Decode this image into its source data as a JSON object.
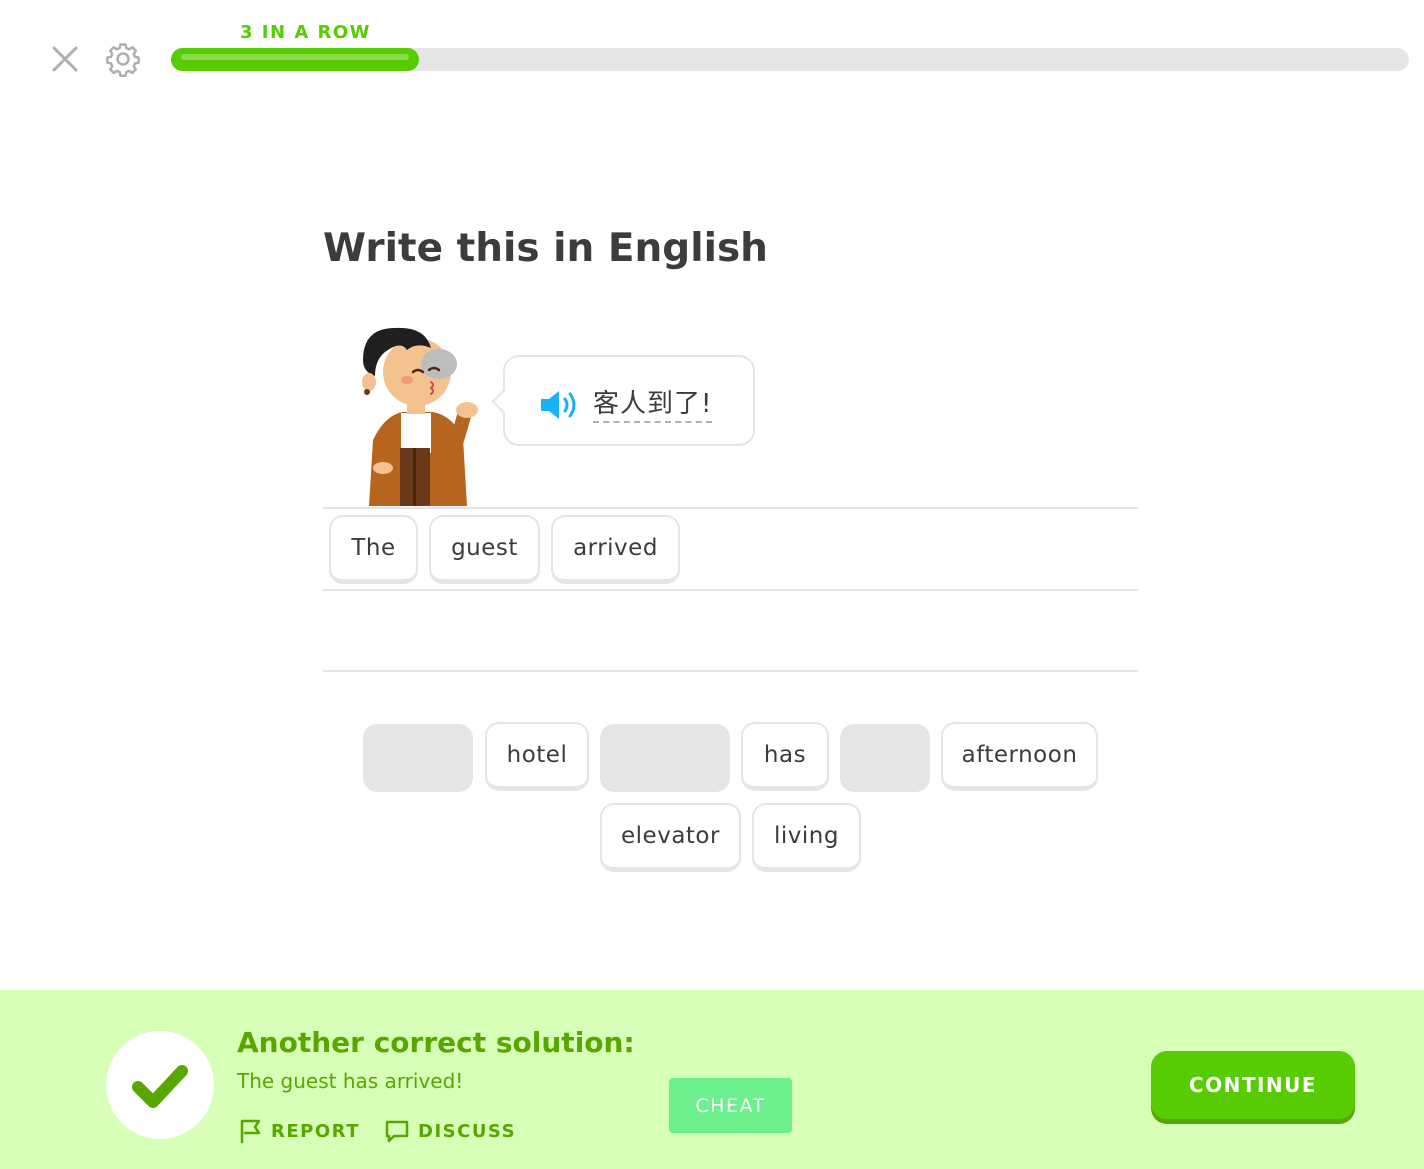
{
  "header": {
    "streak_label": "3 IN A ROW",
    "progress_fraction": 0.2
  },
  "prompt": {
    "title": "Write this in English",
    "sentence": "客人到了!"
  },
  "answer": {
    "tiles": [
      "The",
      "guest",
      "arrived"
    ]
  },
  "word_bank": {
    "row1": [
      "",
      "hotel",
      "",
      "has",
      "",
      "afternoon"
    ],
    "row2": [
      "elevator",
      "living"
    ]
  },
  "footer": {
    "title": "Another correct solution:",
    "solution": "The guest has arrived!",
    "report_label": "REPORT",
    "discuss_label": "DISCUSS",
    "cheat_label": "CHEAT",
    "continue_label": "CONTINUE"
  },
  "colors": {
    "brand_green": "#58cc02",
    "dark_green": "#58a700",
    "footer_bg": "#d7ffb8",
    "speaker_blue": "#1cb0f6"
  },
  "icons": [
    "close-icon",
    "gear-icon",
    "speaker-icon",
    "checkmark-icon",
    "flag-icon",
    "speech-bubble-icon"
  ]
}
